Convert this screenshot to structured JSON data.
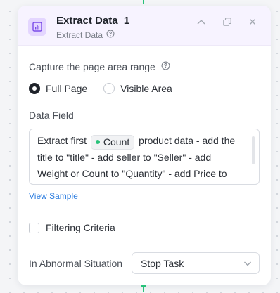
{
  "node": {
    "title": "Extract Data_1",
    "subtitle": "Extract Data",
    "icon": "bar-chart-icon",
    "accent": "#8a5cf6",
    "header_bg": "#f7f3ff"
  },
  "capture": {
    "label": "Capture the page area range",
    "options": [
      {
        "label": "Full Page",
        "selected": true
      },
      {
        "label": "Visible Area",
        "selected": false
      }
    ]
  },
  "data_field": {
    "label": "Data Field",
    "text_before": "Extract first",
    "chip": "Count",
    "text_after": "product data - add the title to \"title\" - add seller to \"Seller\" - add Weight or Count to \"Quantity\" - add Price to"
  },
  "view_sample": "View Sample",
  "filtering": {
    "label": "Filtering Criteria",
    "checked": false
  },
  "abnormal": {
    "label": "In Abnormal Situation",
    "value": "Stop Task"
  },
  "colors": {
    "connector": "#29c27a",
    "link": "#2f7fe0"
  }
}
